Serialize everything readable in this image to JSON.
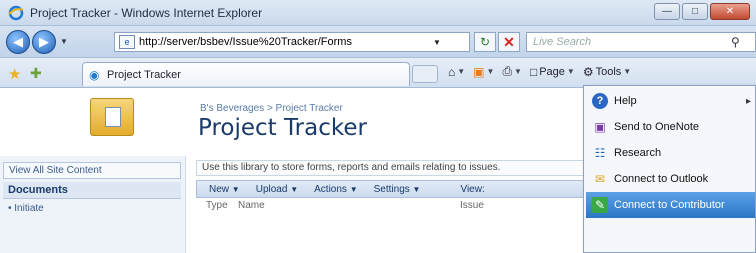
{
  "window": {
    "title": "Project Tracker - Windows Internet Explorer"
  },
  "address": {
    "url": "http://server/bsbev/Issue%20Tracker/Forms",
    "search_placeholder": "Live Search"
  },
  "tabbar": {
    "tab_label": "Project Tracker"
  },
  "commands": {
    "page_label": "Page",
    "tools_label": "Tools"
  },
  "site": {
    "breadcrumb": "B's Beverages > Project Tracker",
    "title": "Project Tracker",
    "description": "Use this library to store forms, reports and emails relating to issues."
  },
  "leftnav": {
    "view_all": "View All Site Content",
    "documents_heading": "Documents",
    "items": [
      "Initiate"
    ]
  },
  "list_toolbar": {
    "new": "New",
    "upload": "Upload",
    "actions": "Actions",
    "settings": "Settings",
    "view": "View:"
  },
  "list_columns": [
    "Type",
    "Name",
    "Issue"
  ],
  "menu": {
    "items": [
      {
        "label": "Help",
        "icon": "help-icon"
      },
      {
        "label": "Send to OneNote",
        "icon": "onenote-icon"
      },
      {
        "label": "Research",
        "icon": "research-icon"
      },
      {
        "label": "Connect to Outlook",
        "icon": "outlook-icon"
      },
      {
        "label": "Connect to Contributor",
        "icon": "contributor-icon"
      }
    ],
    "selected_index": 4
  }
}
